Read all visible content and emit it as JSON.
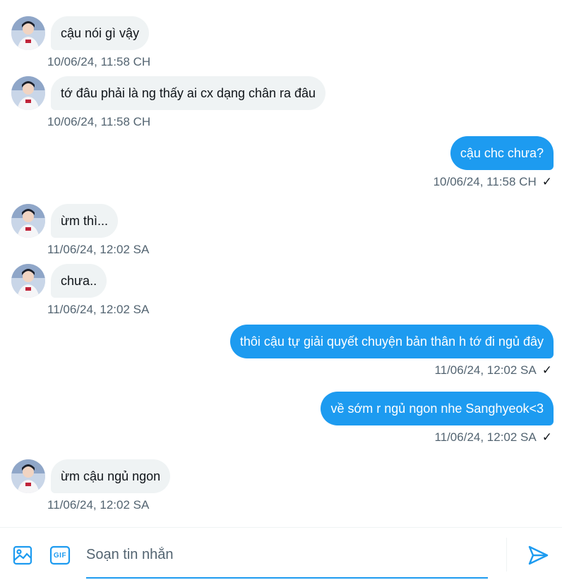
{
  "colors": {
    "accent": "#1d9bf0",
    "incoming_bubble": "#eff3f4",
    "timestamp": "#536471"
  },
  "messages": [
    {
      "direction": "in",
      "text": "cậu nói gì vậy",
      "time": "10/06/24, 11:58 CH"
    },
    {
      "direction": "in",
      "text": "tớ đâu phải là ng thấy ai cx dạng chân ra đâu",
      "time": "10/06/24, 11:58 CH"
    },
    {
      "direction": "out",
      "text": "cậu chc chưa?",
      "time": "10/06/24, 11:58 CH",
      "status_icon": "check-icon"
    },
    {
      "direction": "in",
      "text": "ừm thì...",
      "time": "11/06/24, 12:02 SA"
    },
    {
      "direction": "in",
      "text": "chưa..",
      "time": "11/06/24, 12:02 SA"
    },
    {
      "direction": "out",
      "text": "thôi cậu tự giải quyết chuyện bản thân h tớ đi ngủ đây",
      "time": "11/06/24, 12:02 SA",
      "status_icon": "check-icon"
    },
    {
      "direction": "out",
      "text": "về sớm r ngủ ngon nhe Sanghyeok<3",
      "time": "11/06/24, 12:02 SA",
      "status_icon": "check-icon"
    },
    {
      "direction": "in",
      "text": "ừm cậu ngủ ngon",
      "time": "11/06/24, 12:02 SA"
    }
  ],
  "composer": {
    "placeholder": "Soạn tin nhắn",
    "value": "",
    "media_icon": "image-icon",
    "gif_icon": "gif-icon",
    "gif_label": "GIF",
    "send_icon": "send-icon"
  }
}
